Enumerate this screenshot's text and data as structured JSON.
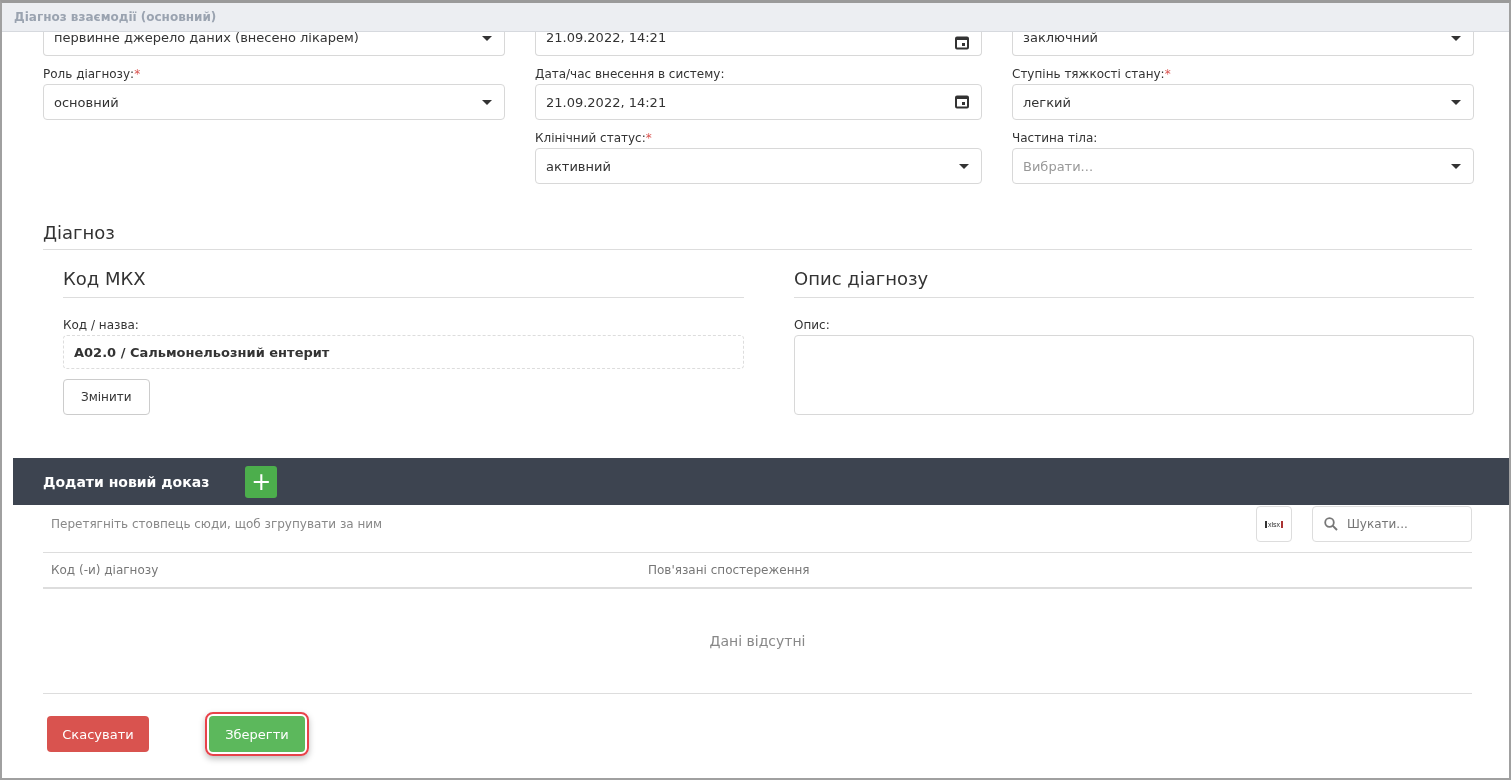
{
  "window": {
    "title": "Діагноз взаємодії (основний)"
  },
  "form_columns": [
    {
      "fields": [
        {
          "kind": "select",
          "value": "первинне джерело даних (внесено лікарем)"
        },
        {
          "kind": "select",
          "label": "Роль діагнозу:",
          "required_mark": "*",
          "value": "основний"
        }
      ]
    },
    {
      "fields": [
        {
          "kind": "date",
          "value": "21.09.2022, 14:21"
        },
        {
          "kind": "date",
          "label": "Дата/час внесення в систему:",
          "value": "21.09.2022, 14:21"
        },
        {
          "kind": "select",
          "label": "Клінічний статус:",
          "required_mark": "*",
          "value": "активний"
        }
      ]
    },
    {
      "fields": [
        {
          "kind": "select",
          "value": "заключний"
        },
        {
          "kind": "select",
          "label": "Ступінь тяжкості стану:",
          "required_mark": "*",
          "value": "легкий"
        },
        {
          "kind": "select",
          "label": "Частина тіла:",
          "placeholder": "Вибрати..."
        }
      ]
    }
  ],
  "diagnosis": {
    "title": "Діагноз",
    "icd": {
      "title": "Код МКХ",
      "label": "Код / назва:",
      "value": "A02.0 / Сальмонельозний ентерит",
      "change_button": "Змінити"
    },
    "description": {
      "title": "Опис діагнозу",
      "label": "Опис:"
    }
  },
  "evidence": {
    "title": "Додати новий доказ",
    "add_button": "+",
    "group_hint": "Перетягніть стовпець сюди, щоб згрупувати за ним",
    "export_label": "xlsx",
    "search": {
      "placeholder": "Шукати..."
    },
    "columns": [
      "Код (-и) діагнозу",
      "Пов'язані спостереження"
    ],
    "empty": "Дані відсутні"
  },
  "buttons": [
    {
      "kind": "cancel",
      "label": "Скасувати",
      "focused": false
    },
    {
      "kind": "save",
      "label": "Зберегти",
      "focused": true
    }
  ]
}
